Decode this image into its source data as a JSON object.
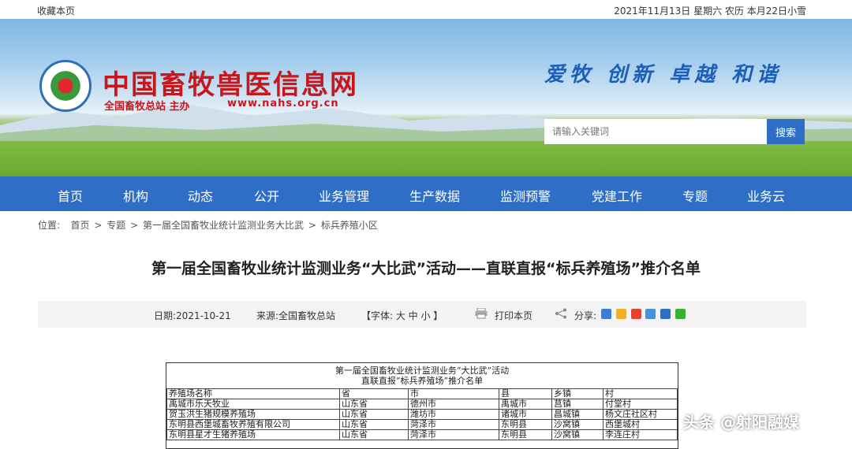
{
  "topbar": {
    "favorite": "收藏本页",
    "date": "2021年11月13日 星期六 农历 本月22日小雪"
  },
  "header": {
    "site_name": "中国畜牧兽医信息网",
    "sponsor": "全国畜牧总站 主办",
    "url": "www.nahs.org.cn",
    "slogan": "爱牧 创新 卓越 和谐"
  },
  "search": {
    "placeholder": "请输入关键词",
    "button": "搜索"
  },
  "nav": [
    "首页",
    "机构",
    "动态",
    "公开",
    "业务管理",
    "生产数据",
    "监测预警",
    "党建工作",
    "专题",
    "业务云"
  ],
  "breadcrumb": {
    "label": "位置:",
    "items": [
      "首页",
      "专题",
      "第一届全国畜牧业统计监测业务大比武",
      "标兵养殖小区"
    ],
    "sep": ">"
  },
  "article": {
    "title": "第一届全国畜牧业统计监测业务“大比武”活动——直联直报“标兵养殖场”推介名单",
    "date": "日期:2021-10-21",
    "source": "来源:全国畜牧总站",
    "font_size": "【字体: 大 中 小 】",
    "print": "打印本页",
    "share": "分享:"
  },
  "document": {
    "heading_line1": "第一届全国畜牧业统计监测业务“大比武”活动",
    "heading_line2": "直联直报“标兵养殖场”推介名单",
    "columns": [
      "养殖场名称",
      "省",
      "市",
      "县",
      "乡镇",
      "村"
    ],
    "rows": [
      [
        "禹城市乐天牧业",
        "山东省",
        "德州市",
        "禹城市",
        "莒镇",
        "付堂村"
      ],
      [
        "贺玉洪生猪规模养殖场",
        "山东省",
        "潍坊市",
        "诸城市",
        "昌城镇",
        "杨文庄社区村"
      ],
      [
        "东明县西堡城畜牧养殖有限公司",
        "山东省",
        "菏泽市",
        "东明县",
        "沙窝镇",
        "西堡城村"
      ],
      [
        "东明县星才生猪养殖场",
        "山东省",
        "菏泽市",
        "东明县",
        "沙窝镇",
        "李连庄村"
      ]
    ]
  },
  "watermark": "头条 @射阳融媒",
  "colors": {
    "nav_bg": "#2f6ec7",
    "brand_red": "#c8161d",
    "slogan_blue": "#1d5fb8"
  }
}
